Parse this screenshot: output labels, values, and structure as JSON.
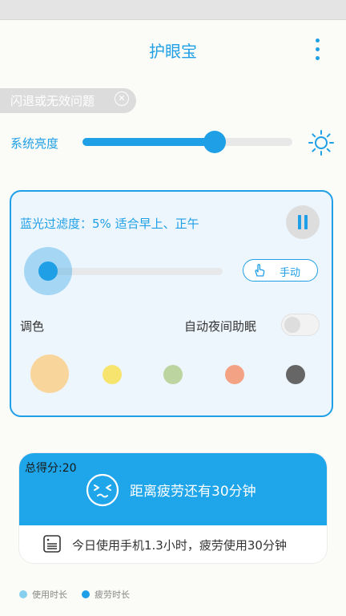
{
  "app": {
    "title": "护眼宝"
  },
  "crash_chip": {
    "label": "闪退或无效问题",
    "close_icon": "close-circle-icon"
  },
  "brightness": {
    "label": "系统亮度",
    "value_fraction": 0.63,
    "icon": "sun-icon"
  },
  "filter_card": {
    "filter_text": "蓝光过滤度：5% 适合早上、正午",
    "filter_value_fraction": 0.05,
    "manual_button": "手动",
    "tone_label": "调色",
    "night_label": "自动夜间助眠",
    "night_toggle_on": false,
    "swatches": [
      "#f8d59a",
      "#f7e46e",
      "#bcd4a0",
      "#f3a283",
      "#666666"
    ],
    "accent": "#1e9fe6"
  },
  "score": {
    "label": "总得分:20",
    "fatigue_text": "距离疲劳还有30分钟",
    "usage_text": "今日使用手机1.3小时，疲劳使用30分钟"
  },
  "legend": [
    {
      "label": "使用时长",
      "color": "#87cfee"
    },
    {
      "label": "疲劳时长",
      "color": "#1e9fe6"
    }
  ]
}
